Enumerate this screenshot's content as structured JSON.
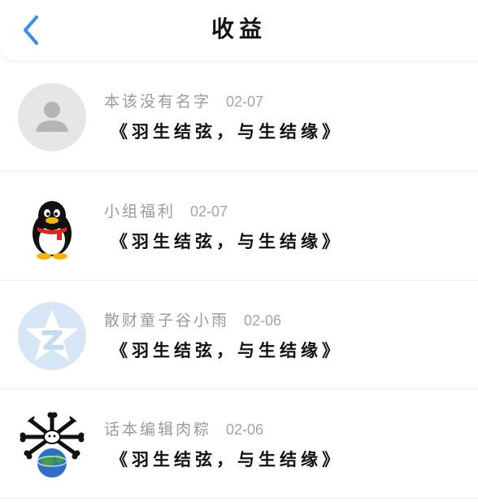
{
  "header": {
    "title": "收益",
    "back_icon": "chevron-left-icon",
    "accent_color": "#3a8ee6"
  },
  "items": [
    {
      "name": "本该没有名字",
      "date": "02-07",
      "message": "《羽生结弦，与生结缘》",
      "avatar": "default-person-avatar"
    },
    {
      "name": "小组福利",
      "date": "02-07",
      "message": "《羽生结弦，与生结缘》",
      "avatar": "qq-penguin-avatar"
    },
    {
      "name": "散财童子谷小雨",
      "date": "02-06",
      "message": "《羽生结弦，与生结缘》",
      "avatar": "star-z-avatar"
    },
    {
      "name": "话本编辑肉粽",
      "date": "02-06",
      "message": "《羽生结弦，与生结缘》",
      "avatar": "earth-bones-avatar"
    }
  ]
}
